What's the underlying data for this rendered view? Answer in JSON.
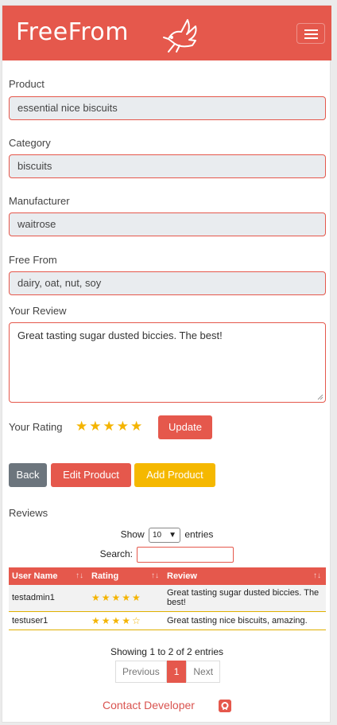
{
  "brand": {
    "name": "FreeFrom",
    "logo_icon": "dove-icon"
  },
  "form": {
    "product_label": "Product",
    "product_value": "essential nice biscuits",
    "category_label": "Category",
    "category_value": "biscuits",
    "manufacturer_label": "Manufacturer",
    "manufacturer_value": "waitrose",
    "freefrom_label": "Free From",
    "freefrom_value": "dairy, oat, nut, soy",
    "review_label": "Your Review",
    "review_value": "Great tasting sugar dusted biccies. The best!",
    "rating_label": "Your Rating",
    "rating_value": 5,
    "rating_stars": "★★★★★",
    "update_label": "Update"
  },
  "actions": {
    "back_label": "Back",
    "edit_label": "Edit Product",
    "add_label": "Add Product"
  },
  "reviews": {
    "title": "Reviews",
    "show_label": "Show",
    "show_value": "10",
    "entries_label": "entries",
    "search_label": "Search:",
    "columns": [
      "User Name",
      "Rating",
      "Review"
    ],
    "rows": [
      {
        "user": "testadmin1",
        "rating": 5,
        "stars": "★★★★★",
        "review": "Great tasting sugar dusted biccies. The best!"
      },
      {
        "user": "testuser1",
        "rating": 4,
        "stars": "★★★★☆",
        "review": "Great tasting nice biscuits, amazing."
      }
    ],
    "info": "Showing 1 to 2 of 2 entries",
    "pager": {
      "previous": "Previous",
      "page": "1",
      "next": "Next"
    }
  },
  "footer": {
    "contact_label": "Contact Developer",
    "contact_icon": "github-icon"
  },
  "colors": {
    "primary": "#e5584c",
    "warning": "#f5b800",
    "secondary": "#6c757d",
    "star": "#f4b400"
  }
}
